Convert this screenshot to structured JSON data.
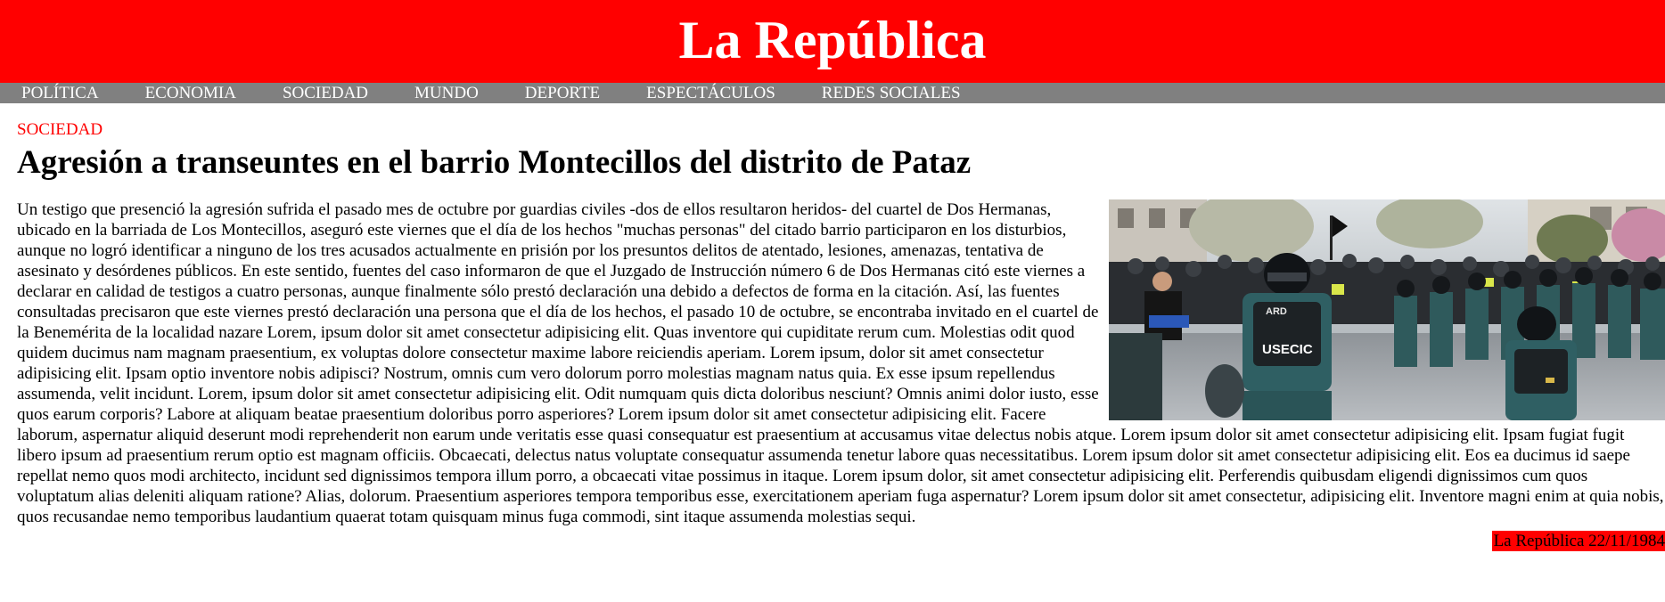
{
  "site": {
    "title": "La República"
  },
  "nav": {
    "items": [
      {
        "label": "POLÍTICA"
      },
      {
        "label": "ECONOMIA"
      },
      {
        "label": "SOCIEDAD"
      },
      {
        "label": "MUNDO"
      },
      {
        "label": "DEPORTE"
      },
      {
        "label": "ESPECTÁCULOS"
      },
      {
        "label": "REDES SOCIALES"
      }
    ]
  },
  "article": {
    "section": "SOCIEDAD",
    "headline": "Agresión a transeuntes en el barrio Montecillos del distrito de Pataz",
    "image_alt": "Agentes de la Guardia Civil con cascos formando un cordón frente a una multitud; chaleco con la inscripción USECIC",
    "image_labels": {
      "vest": "USECIC",
      "vest_top": "ARD"
    },
    "body": "Un testigo que presenció la agresión sufrida el pasado mes de octubre por guardias civiles -dos de ellos resultaron heridos- del cuartel de Dos Hermanas, ubicado en la barriada de Los Montecillos, aseguró este viernes que el día de los hechos \"muchas personas\" del citado barrio participaron en los disturbios, aunque no logró identificar a ninguno de los tres acusados actualmente en prisión por los presuntos delitos de atentado, lesiones, amenazas, tentativa de asesinato y desórdenes públicos. En este sentido, fuentes del caso informaron de que el Juzgado de Instrucción número 6 de Dos Hermanas citó este viernes a declarar en calidad de testigos a cuatro personas, aunque finalmente sólo prestó declaración una debido a defectos de forma en la citación. Así, las fuentes consultadas precisaron que este viernes prestó declaración una persona que el día de los hechos, el pasado 10 de octubre, se encontraba invitado en el cuartel de la Benemérita de la localidad nazare Lorem, ipsum dolor sit amet consectetur adipisicing elit. Quas inventore qui cupiditate rerum cum. Molestias odit quod quidem ducimus nam magnam praesentium, ex voluptas dolore consectetur maxime labore reiciendis aperiam. Lorem ipsum, dolor sit amet consectetur adipisicing elit. Ipsam optio inventore nobis adipisci? Nostrum, omnis cum vero dolorum porro molestias magnam natus quia. Ex esse ipsum repellendus assumenda, velit incidunt. Lorem, ipsum dolor sit amet consectetur adipisicing elit. Odit numquam quis dicta doloribus nesciunt? Omnis animi dolor iusto, esse quos earum corporis? Labore at aliquam beatae praesentium doloribus porro asperiores? Lorem ipsum dolor sit amet consectetur adipisicing elit. Facere laborum, aspernatur aliquid deserunt modi reprehenderit non earum unde veritatis esse quasi consequatur est praesentium at accusamus vitae delectus nobis atque. Lorem ipsum dolor sit amet consectetur adipisicing elit. Ipsam fugiat fugit libero ipsum ad praesentium rerum optio est magnam officiis. Obcaecati, delectus natus voluptate consequatur assumenda tenetur labore quas necessitatibus. Lorem ipsum dolor sit amet consectetur adipisicing elit. Eos ea ducimus id saepe repellat nemo quos modi architecto, incidunt sed dignissimos tempora illum porro, a obcaecati vitae possimus in itaque. Lorem ipsum dolor, sit amet consectetur adipisicing elit. Perferendis quibusdam eligendi dignissimos cum quos voluptatum alias deleniti aliquam ratione? Alias, dolorum. Praesentium asperiores tempora temporibus esse, exercitationem aperiam fuga aspernatur? Lorem ipsum dolor sit amet consectetur, adipisicing elit. Inventore magni enim at quia nobis, quos recusandae nemo temporibus laudantium quaerat totam quisquam minus fuga commodi, sint itaque assumenda molestias sequi."
  },
  "footer": {
    "tag": "La República 22/11/1984"
  },
  "colors": {
    "brand": "#ff0000",
    "nav": "#808080",
    "text": "#000000"
  }
}
